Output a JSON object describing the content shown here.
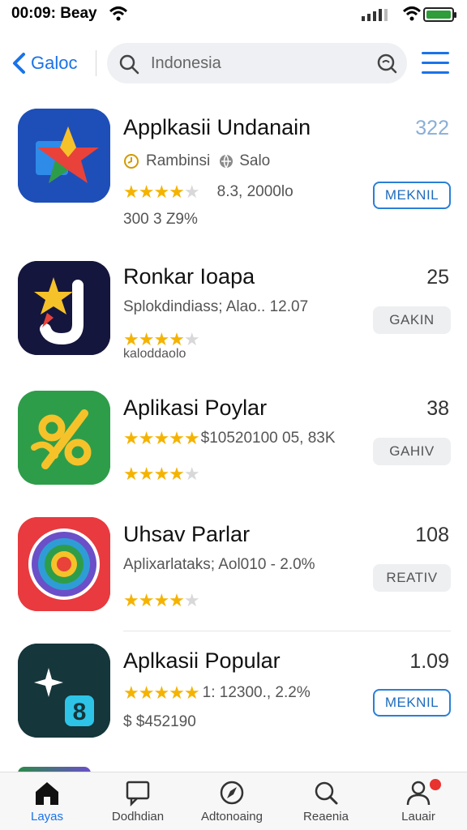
{
  "status_bar": {
    "time": "00:09: Beay",
    "icons": [
      "wifi-icon",
      "signal-icon",
      "wifi-icon",
      "battery-icon"
    ],
    "battery_color": "#2e9d3a"
  },
  "nav": {
    "back_label": "Galoc",
    "search_value": "Indonesia",
    "icons": [
      "chevron-left-icon",
      "search-icon",
      "search-icon",
      "menu-icon"
    ],
    "accent": "#1a73e8"
  },
  "apps": [
    {
      "name": "Applkasii Undanain",
      "meta_a": "Rambinsi",
      "meta_b": "Salo",
      "rating": 4.5,
      "rating_text": "8.3, 2000lo",
      "sub": "300  3 Z9%",
      "rank": "322",
      "button": "MEKNIL",
      "button_style": "outline"
    },
    {
      "name": "Ronkar Ioapa",
      "sub": "Splokdindiass; Alao.. 12.07",
      "rating": 4.5,
      "rating_text": "",
      "extra": "kaloddaolo",
      "rank": "25",
      "button": "GAKIN",
      "button_style": "grey"
    },
    {
      "name": "Aplikasi Poylar",
      "rating": 5,
      "rating_text": "$10520100 05, 83K",
      "rating2": 4.5,
      "rank": "38",
      "button": "GAHIV",
      "button_style": "grey"
    },
    {
      "name": "Uhsav Parlar",
      "sub": "Aplixarlataks; Aol010 - 2.0%",
      "rating": 4.5,
      "rank": "108",
      "button": "REATIV",
      "button_style": "grey"
    },
    {
      "name": "Aplkasii Popular",
      "rating": 5,
      "rating_text": "1: 12300., 2.2%",
      "price": "$ $452190",
      "rank": "1.09",
      "button": "MEKNIL",
      "button_style": "outline"
    }
  ],
  "tabs": [
    {
      "label": "Layas",
      "icon": "home-icon",
      "active": true
    },
    {
      "label": "Dodhdian",
      "icon": "chat-icon",
      "active": false
    },
    {
      "label": "Adtonoaing",
      "icon": "compass-icon",
      "active": false
    },
    {
      "label": "Reaenia",
      "icon": "search-icon",
      "active": false
    },
    {
      "label": "Lauair",
      "icon": "person-icon",
      "active": false,
      "badge": true
    }
  ],
  "colors": {
    "star": "#f5b301",
    "outline_button": "#2a7fd6",
    "badge": "#e8332f"
  }
}
